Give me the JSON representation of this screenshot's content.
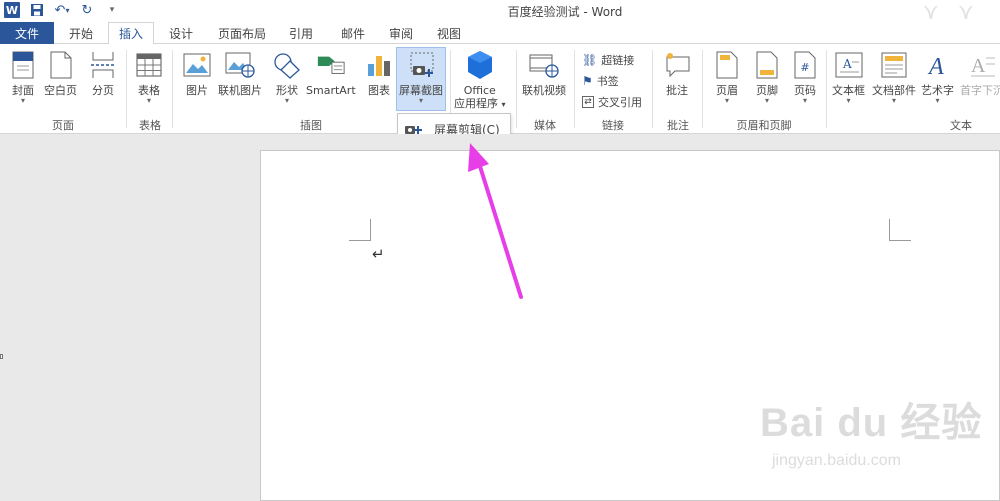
{
  "window": {
    "title": "百度经验测试 - Word"
  },
  "qat": {
    "undo_caret": "▾",
    "more": "▾"
  },
  "tabs": {
    "file": "文件",
    "items": [
      "开始",
      "插入",
      "设计",
      "页面布局",
      "引用",
      "邮件",
      "审阅",
      "视图"
    ],
    "active": "插入"
  },
  "ribbon": {
    "pages": {
      "cover": "封面",
      "blank": "空白页",
      "break": "分页",
      "group": "页面"
    },
    "tables": {
      "table": "表格",
      "group": "表格"
    },
    "illustrations": {
      "picture": "图片",
      "online_picture": "联机图片",
      "shapes": "形状",
      "smartart": "SmartArt",
      "chart": "图表",
      "screenshot": "屏幕截图",
      "group": "插图"
    },
    "apps": {
      "line1": "Office",
      "line2": "应用程序"
    },
    "media": {
      "online_video": "联机视频",
      "group": "媒体"
    },
    "links": {
      "hyperlink": "超链接",
      "bookmark": "书签",
      "cross_ref": "交叉引用",
      "group": "链接"
    },
    "comments": {
      "comment": "批注",
      "group": "批注"
    },
    "header_footer": {
      "header": "页眉",
      "footer": "页脚",
      "page_number": "页码",
      "group": "页眉和页脚"
    },
    "text": {
      "textbox": "文本框",
      "quick_parts": "文档部件",
      "wordart": "艺术字",
      "drop_cap": "首字下沉",
      "group": "文本"
    }
  },
  "dropdown": {
    "item": "屏幕剪辑(C)"
  },
  "colors": {
    "accent": "#2b579a",
    "arrow": "#e83ee8",
    "highlight": "#cde0f7"
  },
  "watermark": {
    "main": "Bai du 经验",
    "sub": "jingyan.baidu.com"
  }
}
